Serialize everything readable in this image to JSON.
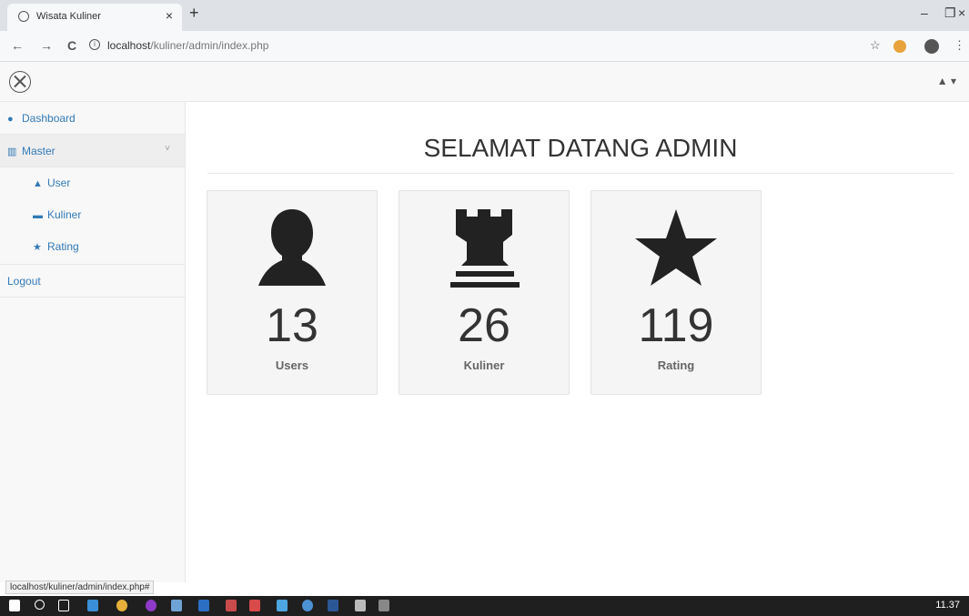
{
  "browser": {
    "tab_title": "Wisata Kuliner",
    "tab_close": "×",
    "new_tab": "+",
    "url_host": "localhost",
    "url_path": "/kuliner/admin/index.php",
    "back": "←",
    "forward": "→",
    "reload": "C",
    "min": "–",
    "max": "❐",
    "close": "×",
    "star": "☆",
    "menu": "⋮"
  },
  "header": {
    "user_icon": "▲ ▾"
  },
  "sidebar": {
    "dashboard": "Dashboard",
    "master": "Master",
    "master_chevron": "˅",
    "user": "User",
    "kuliner": "Kuliner",
    "rating": "Rating",
    "logout": "Logout"
  },
  "main": {
    "title": "SELAMAT DATANG ADMIN",
    "cards": [
      {
        "value": "13",
        "label": "Users",
        "icon": "user-icon"
      },
      {
        "value": "26",
        "label": "Kuliner",
        "icon": "tower-icon"
      },
      {
        "value": "119",
        "label": "Rating",
        "icon": "star-icon"
      }
    ]
  },
  "status_url": "localhost/kuliner/admin/index.php#",
  "taskbar": {
    "time": "11.37"
  }
}
